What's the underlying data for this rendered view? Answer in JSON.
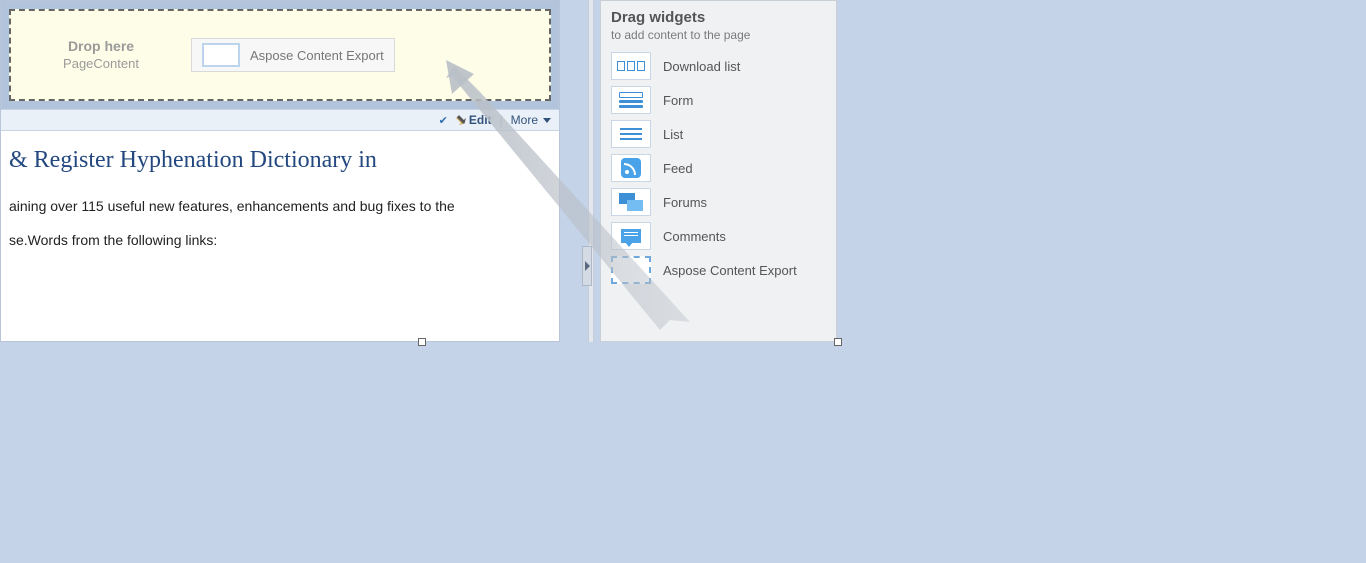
{
  "dropzone": {
    "title": "Drop here",
    "subtitle": "PageContent",
    "dropped_widget_label": "Aspose Content Export"
  },
  "toolbar": {
    "edit_label": "Edit",
    "more_label": "More"
  },
  "article": {
    "title": " & Register Hyphenation Dictionary in",
    "line1": "aining over 115 useful new features, enhancements and bug fixes to the",
    "line2": "se.Words from the following links:"
  },
  "palette": {
    "heading": "Drag widgets",
    "subheading": "to add content to the page",
    "items": [
      {
        "id": "download-list",
        "label": "Download list"
      },
      {
        "id": "form",
        "label": "Form"
      },
      {
        "id": "list",
        "label": "List"
      },
      {
        "id": "feed",
        "label": "Feed"
      },
      {
        "id": "forums",
        "label": "Forums"
      },
      {
        "id": "comments",
        "label": "Comments"
      },
      {
        "id": "aspose-export",
        "label": "Aspose Content Export"
      }
    ]
  }
}
